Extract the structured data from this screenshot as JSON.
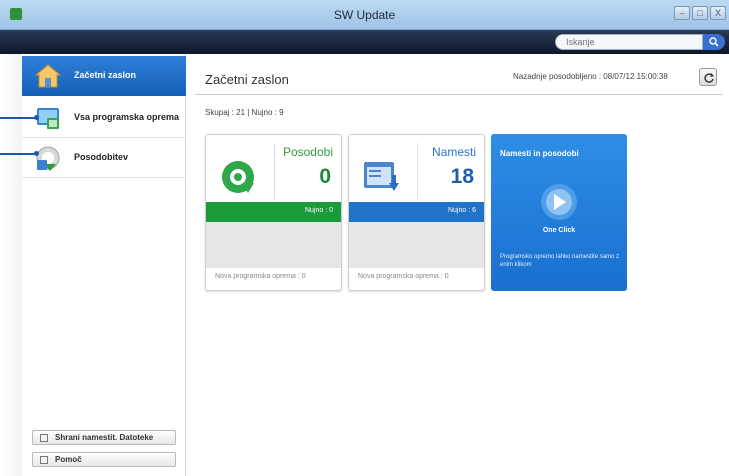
{
  "window": {
    "title": "SW Update",
    "controls": [
      "–",
      "□",
      "X"
    ]
  },
  "search": {
    "placeholder": "Iskanje"
  },
  "sidebar": {
    "items": [
      {
        "label": "Začetni zaslon",
        "icon": "home-icon"
      },
      {
        "label": "Vsa programska oprema",
        "icon": "software-icon"
      },
      {
        "label": "Posodobitev",
        "icon": "update-icon"
      }
    ],
    "bottom_buttons": [
      {
        "label": "Shrani namestit. Datoteke",
        "icon": "save-icon"
      },
      {
        "label": "Pomoč",
        "icon": "help-icon"
      }
    ]
  },
  "main": {
    "title": "Začetni zaslon",
    "last_updated": "Nazadnje posodobljeno : 08/07/12 15:00:38",
    "summary": "Skupaj : 21 | Nujno : 9",
    "cards": [
      {
        "title": "Posodobi",
        "count": "0",
        "urgent": "Nujno : 0",
        "footer": "Nova programska oprema : 0",
        "color": "#1a9a3a"
      },
      {
        "title": "Namesti",
        "count": "18",
        "urgent": "Nujno : 6",
        "footer": "Nova programska oprema : 0",
        "color": "#1f73c9"
      }
    ],
    "one_click": {
      "title": "Namesti in posodobi",
      "label": "One Click",
      "description": "Programsko opremo lahko namestite samo z enim klikom"
    }
  },
  "colors": {
    "accent_blue": "#1f73c9",
    "accent_green": "#1a9a3a",
    "sidebar_active": "#1560b8"
  }
}
